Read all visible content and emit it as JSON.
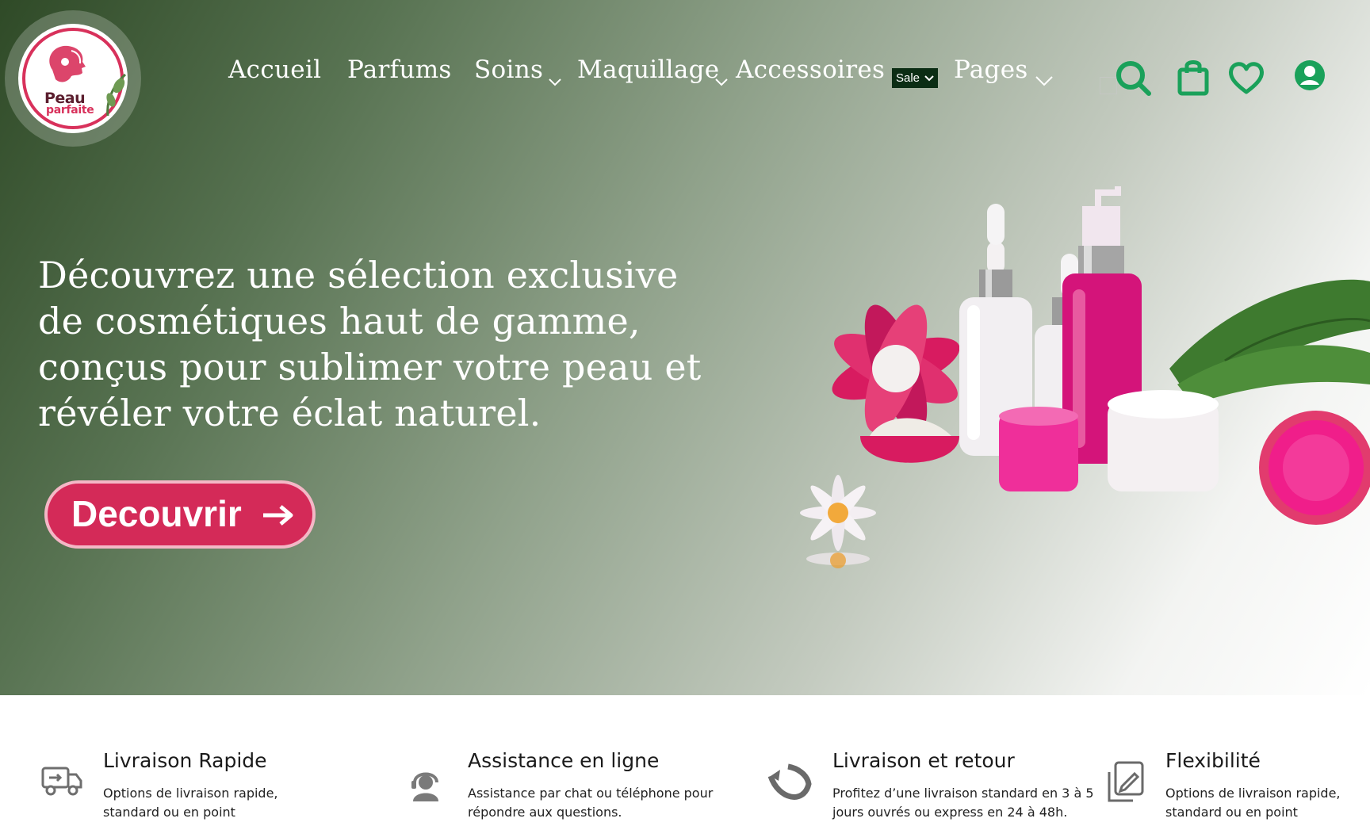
{
  "brand": {
    "word1": "Peau",
    "word2": "parfaite"
  },
  "nav": {
    "items": [
      {
        "label": "Accueil"
      },
      {
        "label": "Parfums"
      },
      {
        "label": "Soins"
      },
      {
        "label": "Maquillage"
      },
      {
        "label": "Accessoires"
      },
      {
        "label": "Pages"
      }
    ],
    "sale_badge": "Sale"
  },
  "header_icons": [
    "search-icon",
    "shopping-bag-icon",
    "heart-icon",
    "account-icon"
  ],
  "hero": {
    "text": "Découvrez une sélection exclusive de cosmétiques haut de gamme, conçus pour sublimer votre peau et révéler votre éclat naturel.",
    "cta_label": "Decouvrir"
  },
  "features": [
    {
      "icon": "truck-icon",
      "title": "Livraison Rapide",
      "desc": "Options de livraison rapide, standard ou en point"
    },
    {
      "icon": "support-headset-icon",
      "title": "Assistance en ligne",
      "desc": "Assistance par chat ou téléphone pour répondre aux questions."
    },
    {
      "icon": "return-arrow-icon",
      "title": "Livraison et retour",
      "desc": "Profitez d’une livraison standard en 3 à 5 jours ouvrés ou express en 24 à 48h."
    },
    {
      "icon": "flexibility-icon",
      "title": "Flexibilité",
      "desc": "Options de livraison rapide, standard ou en point"
    }
  ],
  "colors": {
    "accent_pink": "#d42a58",
    "icon_green": "#1aa15a",
    "hero_dark_green": "#2f4a27"
  }
}
